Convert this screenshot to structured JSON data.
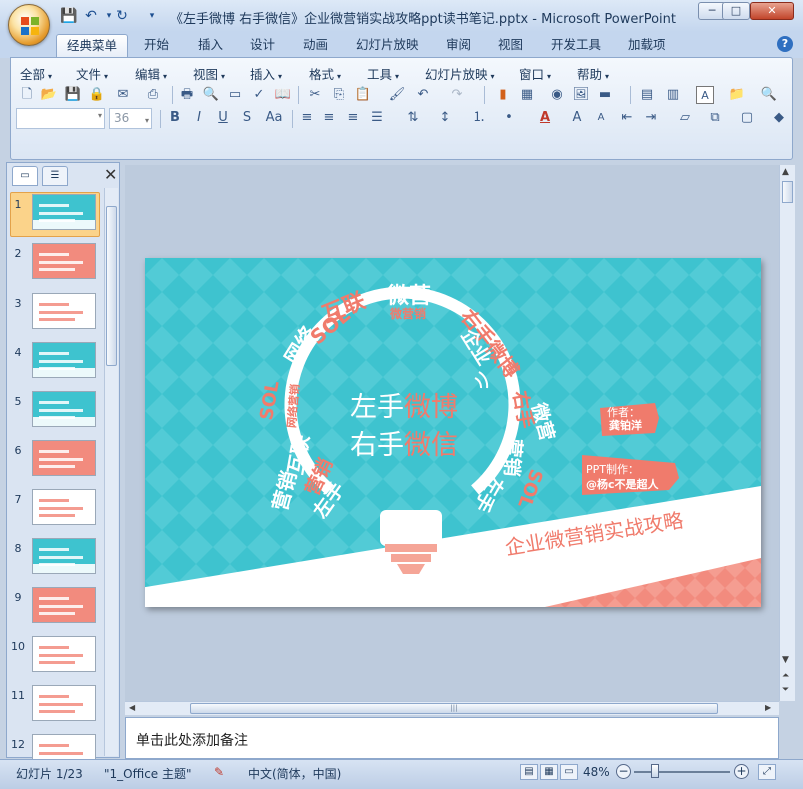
{
  "window": {
    "title": "《左手微博 右手微信》企业微营销实战攻略ppt读书笔记.pptx - Microsoft PowerPoint",
    "qat_icons": [
      "save-icon",
      "undo-icon",
      "redo-icon",
      "customize-icon"
    ],
    "controls": {
      "minimize": "─",
      "maximize": "□",
      "close": "✕"
    }
  },
  "tabs": [
    {
      "label": "经典菜单",
      "active": true
    },
    {
      "label": "开始"
    },
    {
      "label": "插入"
    },
    {
      "label": "设计"
    },
    {
      "label": "动画"
    },
    {
      "label": "幻灯片放映"
    },
    {
      "label": "审阅"
    },
    {
      "label": "视图"
    },
    {
      "label": "开发工具"
    },
    {
      "label": "加载项"
    }
  ],
  "menus": [
    "全部",
    "文件",
    "编辑",
    "视图",
    "插入",
    "格式",
    "工具",
    "幻灯片放映",
    "窗口",
    "帮助"
  ],
  "format_bar": {
    "font_name": "",
    "font_size": "36"
  },
  "slides_pane": {
    "count": 12,
    "selected": 1,
    "labels": [
      "1",
      "2",
      "3",
      "4",
      "5",
      "6",
      "7",
      "8",
      "9",
      "10",
      "11",
      "12"
    ]
  },
  "slide": {
    "title_line1_a": "左手",
    "title_line1_b": "微博",
    "title_line2_a": "右手",
    "title_line2_b": "微信",
    "arc_words": {
      "w1": "网络",
      "w2": "SOL",
      "w3": "互联",
      "w4": "微营",
      "w5": "微营销",
      "w6": "右手微博",
      "w7": "企业",
      "w8": "微营",
      "w9": "右手",
      "w10": "营销",
      "w11": "SOL",
      "w12": "左手",
      "w13": "营销",
      "w14": "SOL",
      "w15": "网络营销",
      "w16": "互联",
      "w17": "营销",
      "w18": "左手"
    },
    "author_label": "作者：",
    "author_name": "龚铂洋",
    "maker_label": "PPT制作：",
    "maker_name": "@杨c不是超人",
    "subtitle": "企业微营销实战攻略",
    "colors": {
      "cyan": "#3ec3cf",
      "coral": "#f07b6c",
      "white": "#ffffff",
      "gray": "#8a8a8a"
    }
  },
  "notes": {
    "placeholder": "单击此处添加备注"
  },
  "status": {
    "slide_info": "幻灯片 1/23",
    "theme": "\"1_Office 主题\"",
    "language": "中文(简体，中国)",
    "zoom": "48%"
  }
}
